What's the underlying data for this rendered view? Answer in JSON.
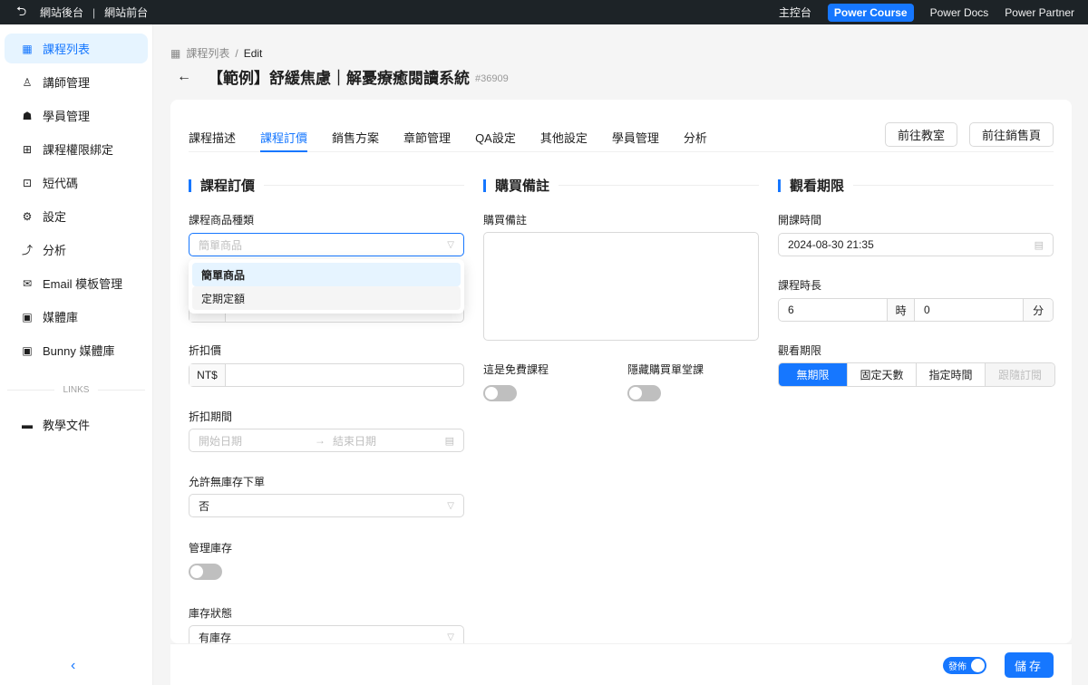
{
  "topbar": {
    "back_label": "網站後台",
    "separator": "|",
    "front_label": "網站前台",
    "links": [
      {
        "label": "主控台"
      },
      {
        "label": "Power Course"
      },
      {
        "label": "Power Docs"
      },
      {
        "label": "Power Partner"
      }
    ]
  },
  "sidebar": {
    "items": [
      {
        "label": "課程列表",
        "icon": "table-icon"
      },
      {
        "label": "講師管理",
        "icon": "user-icon"
      },
      {
        "label": "學員管理",
        "icon": "student-icon"
      },
      {
        "label": "課程權限綁定",
        "icon": "apps-icon"
      },
      {
        "label": "短代碼",
        "icon": "code-icon"
      },
      {
        "label": "設定",
        "icon": "gear-icon"
      },
      {
        "label": "分析",
        "icon": "chart-icon"
      },
      {
        "label": "Email 模板管理",
        "icon": "mail-icon"
      },
      {
        "label": "媒體庫",
        "icon": "media-icon"
      },
      {
        "label": "Bunny 媒體庫",
        "icon": "media-icon"
      }
    ],
    "links_label": "LINKS",
    "link_items": [
      {
        "label": "教學文件",
        "icon": "book-icon"
      }
    ]
  },
  "breadcrumb": {
    "parent": "課程列表",
    "sep": "/",
    "current": "Edit"
  },
  "header": {
    "title": "【範例】舒緩焦慮｜解憂療癒閱讀系統",
    "product_id": "#36909"
  },
  "tabs": [
    {
      "label": "課程描述"
    },
    {
      "label": "課程訂價"
    },
    {
      "label": "銷售方案"
    },
    {
      "label": "章節管理"
    },
    {
      "label": "QA設定"
    },
    {
      "label": "其他設定"
    },
    {
      "label": "學員管理"
    },
    {
      "label": "分析"
    }
  ],
  "actions": {
    "classroom": "前往教室",
    "sales_page": "前往銷售頁"
  },
  "pricing": {
    "title": "課程訂價",
    "product_type_label": "課程商品種類",
    "product_type_placeholder": "簡單商品",
    "product_type_options": [
      "簡單商品",
      "定期定額"
    ],
    "sale_price_label": "折扣價",
    "currency": "NT$",
    "sale_period_label": "折扣期間",
    "start_placeholder": "開始日期",
    "end_placeholder": "結束日期",
    "backorder_label": "允許無庫存下單",
    "backorder_value": "否",
    "manage_stock_label": "管理庫存",
    "stock_status_label": "庫存狀態",
    "stock_status_value": "有庫存"
  },
  "purchase_note": {
    "title": "購買備註",
    "label": "購買備註",
    "free_label": "這是免費課程",
    "hide_single_label": "隱藏購買單堂課"
  },
  "access": {
    "title": "觀看期限",
    "start_label": "開課時間",
    "start_value": "2024-08-30 21:35",
    "duration_label": "課程時長",
    "hours": "6",
    "hours_unit": "時",
    "minutes": "0",
    "minutes_unit": "分",
    "limit_label": "觀看期限",
    "limit_options": [
      "無期限",
      "固定天數",
      "指定時間",
      "跟隨訂閱"
    ]
  },
  "footer": {
    "publish_label": "發佈",
    "save_label": "儲存"
  },
  "colors": {
    "primary": "#1677ff",
    "topbar": "#1d2327"
  }
}
